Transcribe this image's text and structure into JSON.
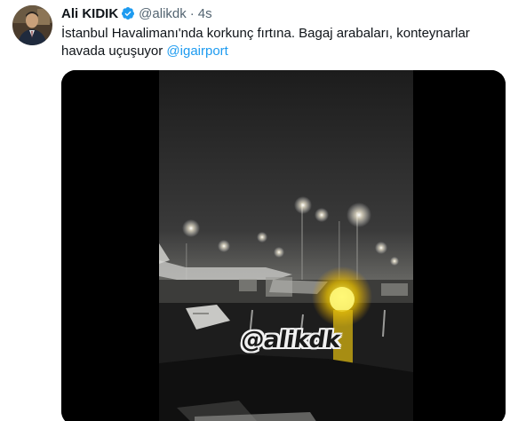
{
  "tweet": {
    "author_name": "Ali KIDIK",
    "author_handle": "@alikdk",
    "separator": "·",
    "timestamp": "4s",
    "text": "İstanbul Havalimanı'nda korkunç fırtına. Bagaj arabaları, konteynarlar havada uçuşuyor ",
    "mention": "@igairport",
    "verified": true,
    "verified_color": "#1d9bf0",
    "mention_color": "#1d9bf0"
  },
  "media": {
    "type": "video",
    "watermark": "@alikdk"
  },
  "icons": {
    "verified": "verified-badge-icon",
    "avatar": "avatar"
  }
}
